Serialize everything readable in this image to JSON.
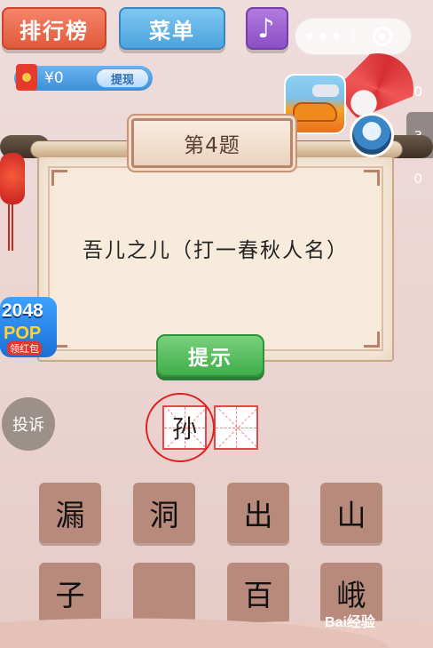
{
  "top_bar": {
    "rank_label": "排行榜",
    "menu_label": "菜单",
    "music_icon": "music-note-icon"
  },
  "capsule": {
    "more_label": "•••",
    "close_icon": "target-circle-icon"
  },
  "wallet": {
    "balance": "¥0",
    "withdraw_label": "提现"
  },
  "side_counts": [
    "0",
    "3",
    "0"
  ],
  "puzzle": {
    "level_title": "第4题",
    "question": "吾儿之儿（打一春秋人名）",
    "hint_label": "提示"
  },
  "ads": {
    "game_2048_number": "2048",
    "game_2048_pop": "POP",
    "game_2048_tag": "领红包"
  },
  "report_label": "投诉",
  "answer": [
    "孙",
    ""
  ],
  "tiles": [
    "漏",
    "洞",
    "出",
    "山",
    "子",
    "",
    "百",
    "峨"
  ],
  "watermark": "Bai经验",
  "colors": {
    "rank": "#e05a3a",
    "menu": "#4ba3de",
    "music": "#8a4fc4",
    "hint": "#3fae4b",
    "tile": "#b78a7c",
    "answer_border": "#e24a4a"
  }
}
